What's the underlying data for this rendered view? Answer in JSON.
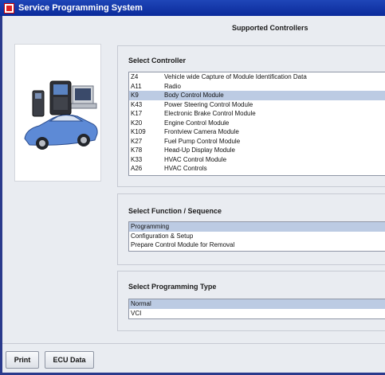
{
  "window": {
    "title": "Service Programming System"
  },
  "header": {
    "title": "Supported Controllers"
  },
  "controller": {
    "title": "Select Controller",
    "items": [
      {
        "code": "Z4",
        "label": "Vehicle wide Capture of Module Identification Data"
      },
      {
        "code": "A11",
        "label": "Radio"
      },
      {
        "code": "K9",
        "label": "Body Control Module"
      },
      {
        "code": "K43",
        "label": "Power Steering Control Module"
      },
      {
        "code": "K17",
        "label": "Electronic Brake Control Module"
      },
      {
        "code": "K20",
        "label": "Engine Control Module"
      },
      {
        "code": "K109",
        "label": "Frontview Camera Module"
      },
      {
        "code": "K27",
        "label": "Fuel Pump Control Module"
      },
      {
        "code": "K78",
        "label": "Head-Up Display Module"
      },
      {
        "code": "K33",
        "label": "HVAC Control Module"
      },
      {
        "code": "A26",
        "label": "HVAC Controls"
      }
    ],
    "selected_index": 2
  },
  "function": {
    "title": "Select Function / Sequence",
    "items": [
      "Programming",
      "Configuration & Setup",
      "Prepare Control Module for Removal"
    ],
    "selected_index": 0
  },
  "programming_type": {
    "title": "Select Programming Type",
    "items": [
      "Normal",
      "VCI"
    ],
    "selected_index": 0
  },
  "buttons": {
    "print": "Print",
    "ecu_data": "ECU Data"
  },
  "colors": {
    "titlebar": "#0a2a9a",
    "selection": "#bccbe3",
    "window_bg": "#e9ecf1"
  },
  "icons": {
    "app": "app-icon",
    "illustration": "scan-tool-and-car-illustration"
  }
}
